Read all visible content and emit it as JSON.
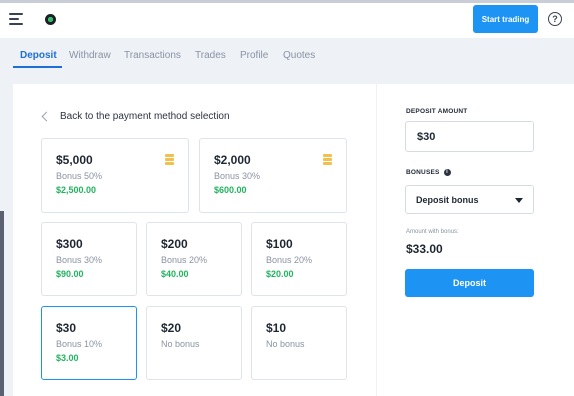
{
  "header": {
    "start_trading_label": "Start trading",
    "help_glyph": "?",
    "menu_icon": "hamburger-menu-icon",
    "logo_icon": "brand-logo-icon"
  },
  "tabs": [
    {
      "label": "Deposit",
      "active": true
    },
    {
      "label": "Withdraw",
      "active": false
    },
    {
      "label": "Transactions",
      "active": false
    },
    {
      "label": "Trades",
      "active": false
    },
    {
      "label": "Profile",
      "active": false
    },
    {
      "label": "Quotes",
      "active": false
    }
  ],
  "back_link": "Back to the payment method selection",
  "options": [
    {
      "amount": "$5,000",
      "bonus": "Bonus 50%",
      "value": "$2,500.00",
      "icon": "coins-icon"
    },
    {
      "amount": "$2,000",
      "bonus": "Bonus 30%",
      "value": "$600.00",
      "icon": "coins-icon"
    },
    {
      "amount": "$300",
      "bonus": "Bonus 30%",
      "value": "$90.00"
    },
    {
      "amount": "$200",
      "bonus": "Bonus 20%",
      "value": "$40.00"
    },
    {
      "amount": "$100",
      "bonus": "Bonus 20%",
      "value": "$20.00"
    },
    {
      "amount": "$30",
      "bonus": "Bonus 10%",
      "value": "$3.00",
      "selected": true
    },
    {
      "amount": "$20",
      "bonus": "No bonus",
      "value": ""
    },
    {
      "amount": "$10",
      "bonus": "No bonus",
      "value": ""
    }
  ],
  "side": {
    "deposit_amount_label": "DEPOSIT AMOUNT",
    "deposit_amount_value": "$30",
    "bonuses_label": "BONUSES",
    "bonus_selected": "Deposit bonus",
    "with_bonus_label": "Amount with bonus:",
    "with_bonus_value": "$33.00",
    "deposit_button": "Deposit"
  },
  "colors": {
    "accent": "#1d93f3",
    "active_tab": "#1d6fd6",
    "bonus_green": "#22b35e"
  }
}
